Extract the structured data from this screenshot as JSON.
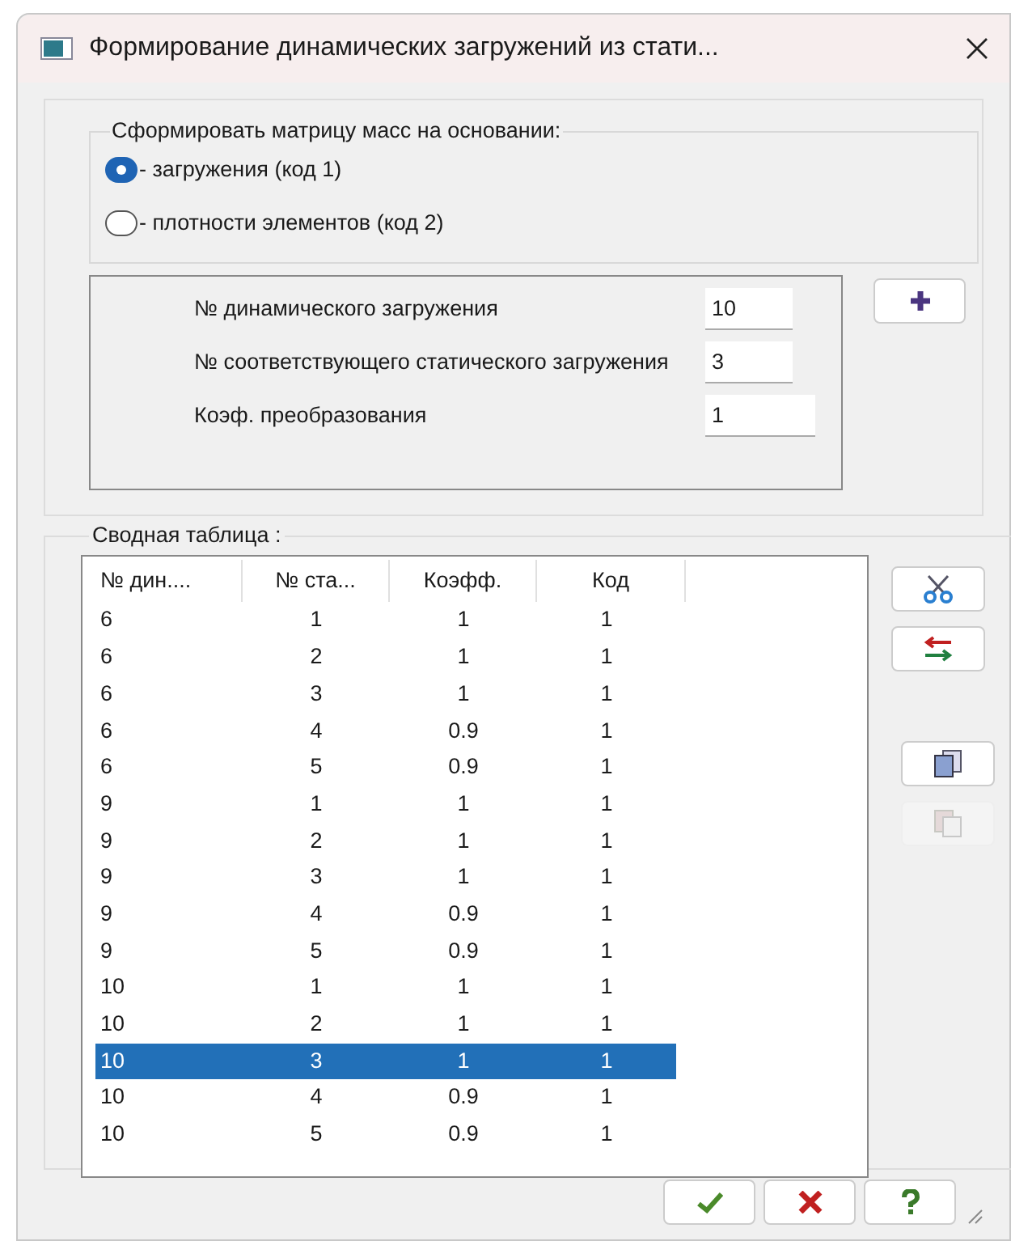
{
  "window": {
    "title": "Формирование динамических загружений из стати..."
  },
  "mass_group": {
    "legend": "Сформировать матрицу масс на основании:",
    "options": [
      {
        "label": "- загружения (код 1)",
        "selected": true
      },
      {
        "label": "- плотности элементов (код 2)",
        "selected": false
      }
    ]
  },
  "params": [
    {
      "label": "№  динамического загружения",
      "value": "10"
    },
    {
      "label": "№ соответствующего статического загружения",
      "value": "3"
    },
    {
      "label": "Коэф. преобразования",
      "value": "1"
    }
  ],
  "summary": {
    "legend": "Сводная таблица :",
    "columns": [
      "№ дин....",
      "№ ста...",
      "Коэфф.",
      "Код"
    ],
    "rows": [
      {
        "cells": [
          "6",
          "1",
          "1",
          "1"
        ],
        "selected": false
      },
      {
        "cells": [
          "6",
          "2",
          "1",
          "1"
        ],
        "selected": false
      },
      {
        "cells": [
          "6",
          "3",
          "1",
          "1"
        ],
        "selected": false
      },
      {
        "cells": [
          "6",
          "4",
          "0.9",
          "1"
        ],
        "selected": false
      },
      {
        "cells": [
          "6",
          "5",
          "0.9",
          "1"
        ],
        "selected": false
      },
      {
        "cells": [
          "9",
          "1",
          "1",
          "1"
        ],
        "selected": false
      },
      {
        "cells": [
          "9",
          "2",
          "1",
          "1"
        ],
        "selected": false
      },
      {
        "cells": [
          "9",
          "3",
          "1",
          "1"
        ],
        "selected": false
      },
      {
        "cells": [
          "9",
          "4",
          "0.9",
          "1"
        ],
        "selected": false
      },
      {
        "cells": [
          "9",
          "5",
          "0.9",
          "1"
        ],
        "selected": false
      },
      {
        "cells": [
          "10",
          "1",
          "1",
          "1"
        ],
        "selected": false
      },
      {
        "cells": [
          "10",
          "2",
          "1",
          "1"
        ],
        "selected": false
      },
      {
        "cells": [
          "10",
          "3",
          "1",
          "1"
        ],
        "selected": true
      },
      {
        "cells": [
          "10",
          "4",
          "0.9",
          "1"
        ],
        "selected": false
      },
      {
        "cells": [
          "10",
          "5",
          "0.9",
          "1"
        ],
        "selected": false
      }
    ]
  },
  "side_buttons": [
    {
      "kind": "cut",
      "disabled": false
    },
    {
      "kind": "swap",
      "disabled": false
    },
    {
      "kind": "copy",
      "disabled": false
    },
    {
      "kind": "paste",
      "disabled": true
    }
  ]
}
